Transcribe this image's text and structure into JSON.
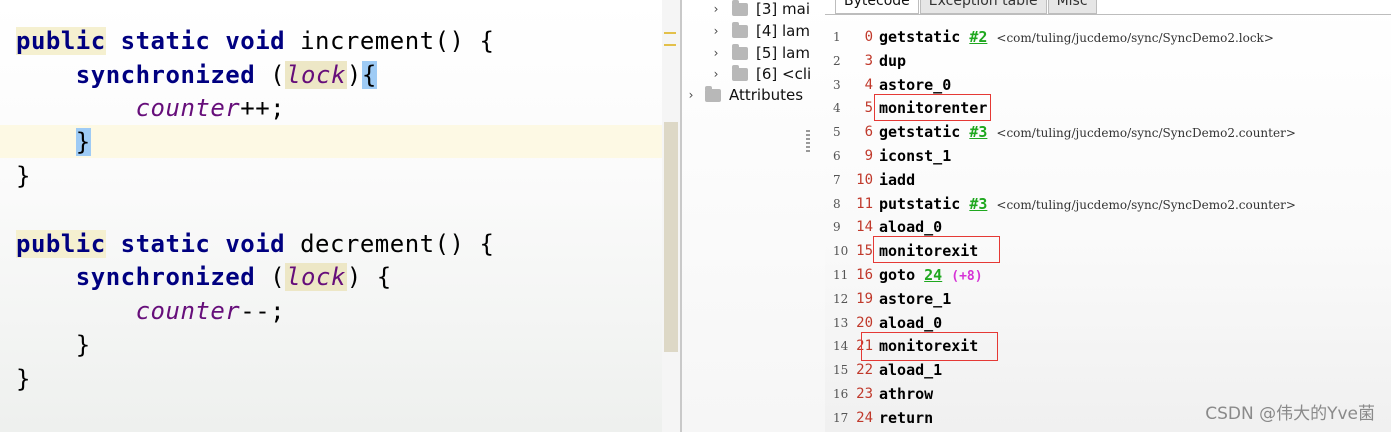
{
  "editor": {
    "lines": [
      {
        "indent": "",
        "kw1": "public",
        "kw2": "static",
        "kw3": "void",
        "name": "increment",
        "tail": "() {"
      },
      {
        "indent": "    ",
        "kw": "synchronized",
        "open": " (",
        "lock": "lock",
        "close": ")",
        "brace": "{"
      },
      {
        "indent": "        ",
        "field": "counter",
        "op": "++;"
      },
      {
        "indent": "    ",
        "brace": "}"
      },
      {
        "indent": "",
        "text": "}"
      },
      {
        "indent": "",
        "kw1": "public",
        "kw2": "static",
        "kw3": "void",
        "name": "decrement",
        "tail": "() {"
      },
      {
        "indent": "    ",
        "kw": "synchronized",
        "open": " (",
        "lock": "lock",
        "close": ")",
        "brace": " {"
      },
      {
        "indent": "        ",
        "field": "counter",
        "op": "--;"
      },
      {
        "indent": "    ",
        "text": "}"
      },
      {
        "indent": "",
        "text": "}"
      }
    ]
  },
  "tree": {
    "items": [
      {
        "label": "[3] mai",
        "chevron": "›"
      },
      {
        "label": "[4] lam",
        "chevron": "›"
      },
      {
        "label": "[5] lam",
        "chevron": "›"
      },
      {
        "label": "[6] <cli",
        "chevron": "›"
      },
      {
        "label": "Attributes",
        "chevron": "›"
      }
    ]
  },
  "bytecode": {
    "tabs": [
      "Bytecode",
      "Exception table",
      "Misc"
    ],
    "rows": [
      {
        "ln": "1",
        "off": "0",
        "op": "getstatic",
        "arg": "#2",
        "ref": "<com/tuling/jucdemo/sync/SyncDemo2.lock>"
      },
      {
        "ln": "2",
        "off": "3",
        "op": "dup"
      },
      {
        "ln": "3",
        "off": "4",
        "op": "astore_0"
      },
      {
        "ln": "4",
        "off": "5",
        "op": "monitorenter"
      },
      {
        "ln": "5",
        "off": "6",
        "op": "getstatic",
        "arg": "#3",
        "ref": "<com/tuling/jucdemo/sync/SyncDemo2.counter>"
      },
      {
        "ln": "6",
        "off": "9",
        "op": "iconst_1"
      },
      {
        "ln": "7",
        "off": "10",
        "op": "iadd"
      },
      {
        "ln": "8",
        "off": "11",
        "op": "putstatic",
        "arg": "#3",
        "ref": "<com/tuling/jucdemo/sync/SyncDemo2.counter>"
      },
      {
        "ln": "9",
        "off": "14",
        "op": "aload_0"
      },
      {
        "ln": "10",
        "off": "15",
        "op": "monitorexit"
      },
      {
        "ln": "11",
        "off": "16",
        "op": "goto",
        "arg": "24",
        "rel": "(+8)"
      },
      {
        "ln": "12",
        "off": "19",
        "op": "astore_1"
      },
      {
        "ln": "13",
        "off": "20",
        "op": "aload_0"
      },
      {
        "ln": "14",
        "off": "21",
        "op": "monitorexit"
      },
      {
        "ln": "15",
        "off": "22",
        "op": "aload_1"
      },
      {
        "ln": "16",
        "off": "23",
        "op": "athrow"
      },
      {
        "ln": "17",
        "off": "24",
        "op": "return"
      }
    ]
  },
  "watermark": "CSDN @伟大的Yve菌",
  "colors": {
    "keyword": "#000080",
    "field": "#660e7a",
    "offset": "#c0392b",
    "arg_link": "#1fa81f",
    "relative": "#d633d6",
    "highlight_box": "#e53935"
  }
}
